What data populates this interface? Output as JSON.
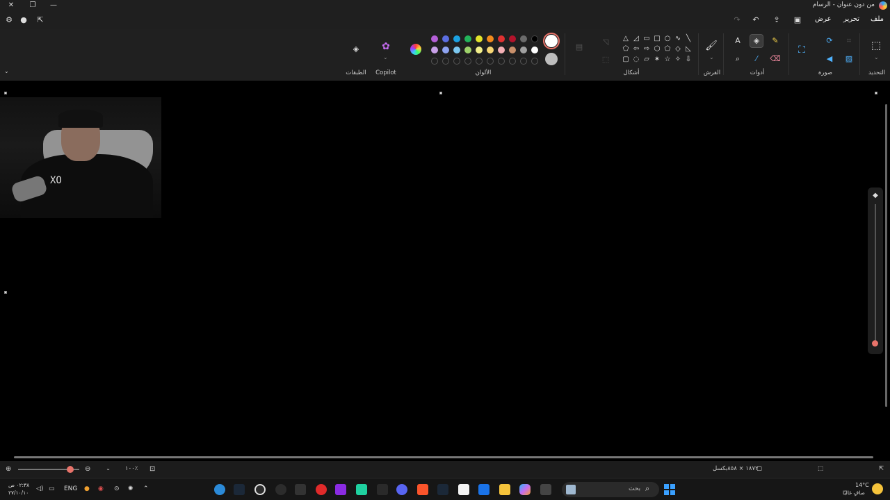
{
  "window": {
    "title": "من دون عنوان - الرسام",
    "controls": [
      "close-icon",
      "restore-icon",
      "minimize-icon"
    ]
  },
  "menu": {
    "file": "ملف",
    "edit": "تحرير",
    "view": "عرض"
  },
  "ribbon": {
    "groups": {
      "selection": "التحديد",
      "image": "صورة",
      "tools": "أدوات",
      "brushes": "الفرش",
      "shapes": "أشكال",
      "colors": "الألوان",
      "copilot": "Copilot",
      "layers": "الطبقات"
    },
    "palette_row1": [
      "#b55fd8",
      "#5b6ee1",
      "#1ba1e2",
      "#23b45a",
      "#e3e32a",
      "#f5c41f",
      "#f28a1c",
      "#e03131",
      "#b3132b",
      "#000000"
    ],
    "palette_row2": [
      "#c8a0e8",
      "#8ea3f0",
      "#7cc8f0",
      "#9ed26a",
      "#f2ef8a",
      "#f7d774",
      "#f3b0b5",
      "#c9906b",
      "#a0a0a0",
      "#ffffff"
    ],
    "primary_color": "#ffffff",
    "secondary_color": "#bdbdbd"
  },
  "canvas": {
    "webcam_overlay_text": "XO"
  },
  "status": {
    "zoom": "١٠٠٪",
    "dimensions": "١٨٧٢ × ٨٥٨بكسل"
  },
  "taskbar": {
    "search_placeholder": "بحث",
    "language": "ENG",
    "time": "٠٢:٣٨ ص",
    "date": "٢٧/١٠/١٠",
    "weather_temp": "14°C",
    "weather_text": "صافٍ غالبًا"
  }
}
